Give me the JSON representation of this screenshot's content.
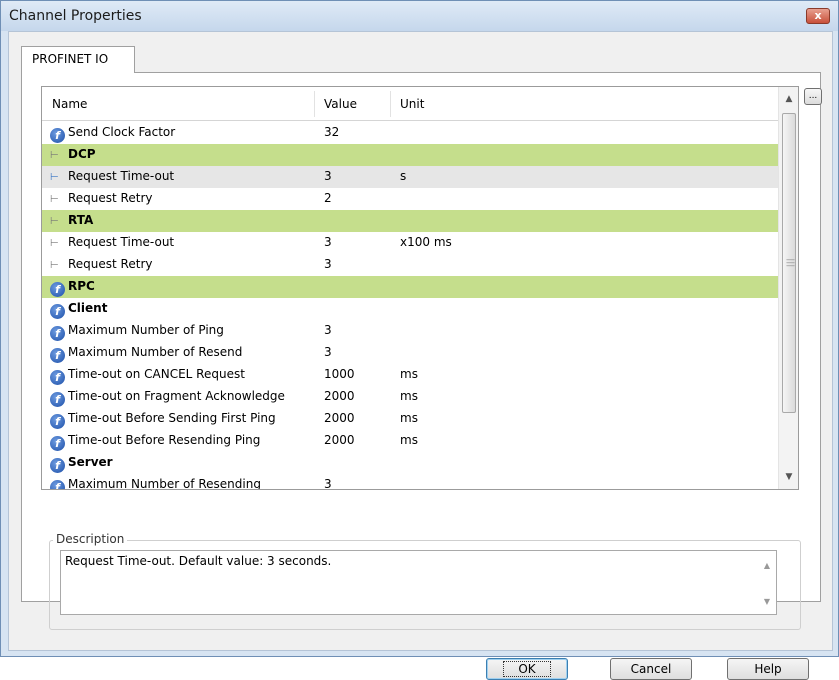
{
  "window": {
    "title": "Channel Properties",
    "close_label": "x"
  },
  "tab": {
    "label": "PROFINET IO"
  },
  "grid": {
    "headers": {
      "name": "Name",
      "value": "Value",
      "unit": "Unit"
    },
    "rows": [
      {
        "type": "param",
        "icon": "f",
        "name": "Send Clock Factor",
        "value": "32",
        "unit": ""
      },
      {
        "type": "group",
        "icon": "pin",
        "name": "DCP",
        "value": "",
        "unit": ""
      },
      {
        "type": "param",
        "icon": "pin-blue",
        "name": "Request Time-out",
        "value": "3",
        "unit": "s",
        "selected": true
      },
      {
        "type": "param",
        "icon": "pin",
        "name": "Request Retry",
        "value": "2",
        "unit": ""
      },
      {
        "type": "group",
        "icon": "pin",
        "name": "RTA",
        "value": "",
        "unit": ""
      },
      {
        "type": "param",
        "icon": "pin",
        "name": "Request Time-out",
        "value": "3",
        "unit": "x100 ms"
      },
      {
        "type": "param",
        "icon": "pin",
        "name": "Request Retry",
        "value": "3",
        "unit": ""
      },
      {
        "type": "group",
        "icon": "f",
        "name": "RPC",
        "value": "",
        "unit": ""
      },
      {
        "type": "subgroup",
        "icon": "f",
        "name": "Client",
        "value": "",
        "unit": ""
      },
      {
        "type": "param",
        "icon": "f",
        "name": "Maximum Number of Ping",
        "value": "3",
        "unit": ""
      },
      {
        "type": "param",
        "icon": "f",
        "name": "Maximum Number of Resend",
        "value": "3",
        "unit": ""
      },
      {
        "type": "param",
        "icon": "f",
        "name": "Time-out on CANCEL Request",
        "value": "1000",
        "unit": "ms"
      },
      {
        "type": "param",
        "icon": "f",
        "name": "Time-out on Fragment Acknowledge",
        "value": "2000",
        "unit": "ms"
      },
      {
        "type": "param",
        "icon": "f",
        "name": "Time-out Before Sending First Ping",
        "value": "2000",
        "unit": "ms"
      },
      {
        "type": "param",
        "icon": "f",
        "name": "Time-out Before Resending Ping",
        "value": "2000",
        "unit": "ms"
      },
      {
        "type": "subgroup",
        "icon": "f",
        "name": "Server",
        "value": "",
        "unit": ""
      },
      {
        "type": "param",
        "icon": "f",
        "name": "Maximum Number of Resending",
        "value": "3",
        "unit": ""
      }
    ]
  },
  "browse_button": {
    "label": "..."
  },
  "description": {
    "legend": "Description",
    "text": "Request Time-out. Default value: 3 seconds."
  },
  "buttons": {
    "ok": "OK",
    "cancel": "Cancel",
    "help": "Help"
  },
  "colors": {
    "group_row": "#c5de8c",
    "selected_row": "#e6e6e6",
    "title_bar": "#d7e4f2"
  }
}
